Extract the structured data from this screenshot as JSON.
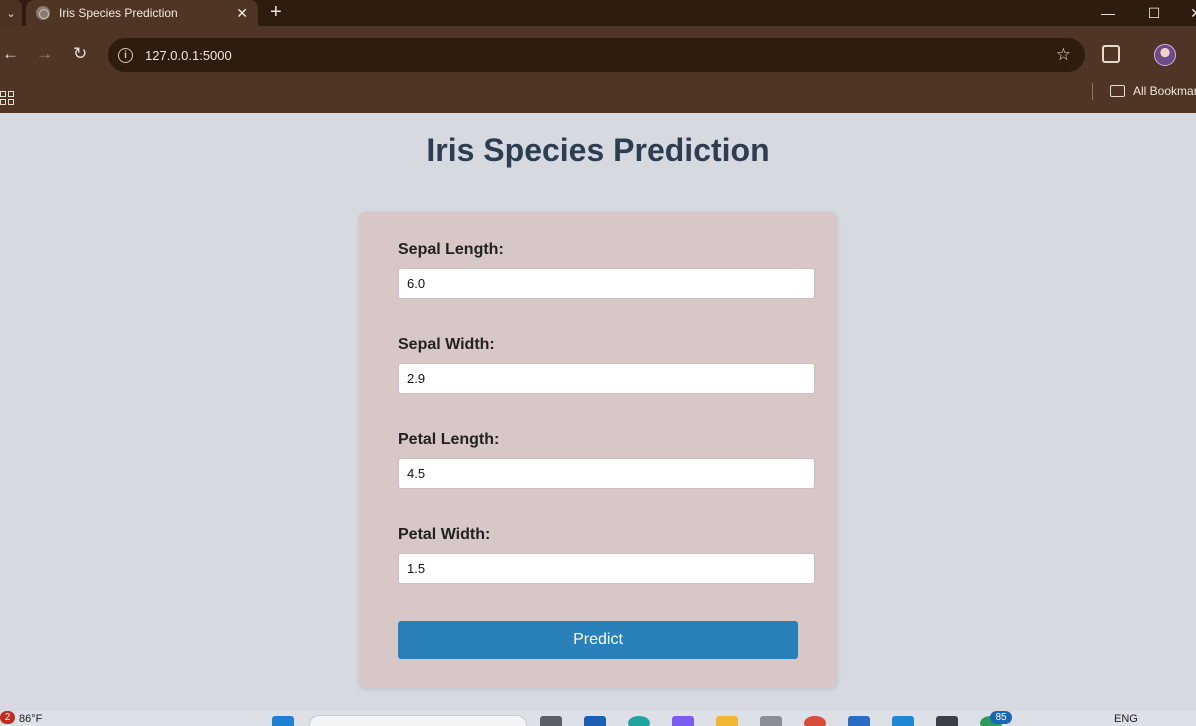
{
  "browser": {
    "tab_title": "Iris Species Prediction",
    "tab_close": "✕",
    "new_tab": "+",
    "url": "127.0.0.1:5000",
    "bookmarks_label": "All Bookmarks"
  },
  "page": {
    "title": "Iris Species Prediction"
  },
  "form": {
    "fields": [
      {
        "label": "Sepal Length:",
        "value": "6.0"
      },
      {
        "label": "Sepal Width:",
        "value": "2.9"
      },
      {
        "label": "Petal Length:",
        "value": "4.5"
      },
      {
        "label": "Petal Width:",
        "value": "1.5"
      }
    ],
    "submit_label": "Predict"
  },
  "taskbar": {
    "weather_badge": "2",
    "temperature": "86°F",
    "notification_count": "85",
    "language": "ENG"
  },
  "colors": {
    "title": "#2c3e50",
    "button": "#2a80b9",
    "card": "#d7c7c6",
    "page_bg": "#d6dae0",
    "chrome": "#4e3525"
  }
}
